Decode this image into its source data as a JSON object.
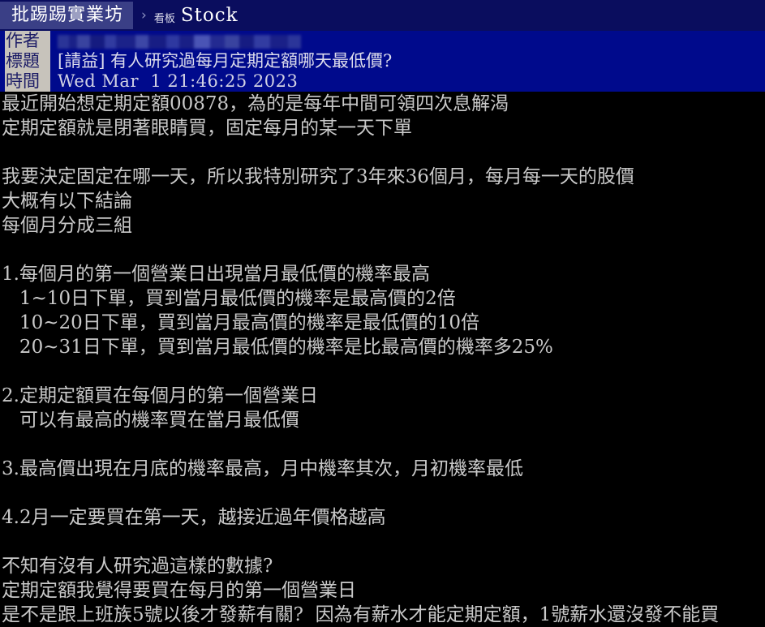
{
  "navbar": {
    "site_name": "批踢踢實業坊",
    "separator": "›",
    "board_word": "看板",
    "board_name": "Stock"
  },
  "meta": {
    "labels": {
      "author": "作者",
      "title": "標題",
      "time": "時間"
    },
    "author_value": "",
    "author_censored": true,
    "title_value": "[請益] 有人研究過每月定期定額哪天最低價?",
    "time_value": "Wed Mar  1 21:46:25 2023"
  },
  "post_body": {
    "lines": [
      "最近開始想定期定額00878，為的是每年中間可領四次息解渴",
      "定期定額就是閉著眼睛買，固定每月的某一天下單",
      "",
      "我要決定固定在哪一天，所以我特別研究了3年來36個月，每月每一天的股價",
      "大概有以下結論",
      "每個月分成三組",
      "",
      "1.每個月的第一個營業日出現當月最低價的機率最高",
      "   1~10日下單，買到當月最低價的機率是最高價的2倍",
      "   10~20日下單，買到當月最高價的機率是最低價的10倍",
      "   20~31日下單，買到當月最低價的機率是比最高價的機率多25%",
      "",
      "2.定期定額買在每個月的第一個營業日",
      "   可以有最高的機率買在當月最低價",
      "",
      "3.最高價出現在月底的機率最高，月中機率其次，月初機率最低",
      "",
      "4.2月一定要買在第一天，越接近過年價格越高",
      "",
      "不知有沒有人研究過這樣的數據?",
      "定期定額我覺得要買在每月的第一個營業日",
      "是不是跟上班族5號以後才發薪有關?  因為有薪水才能定期定額，1號薪水還沒發不能買"
    ]
  },
  "colors": {
    "navbar_bg": "#0a0d5e",
    "site_chip_bg": "#3a3f86",
    "meta_block_bg": "#000a8c",
    "meta_label_bg": "#c7c3bb",
    "meta_label_text": "#1c1c66",
    "body_bg": "#000000",
    "body_text": "#c9c9c9"
  }
}
